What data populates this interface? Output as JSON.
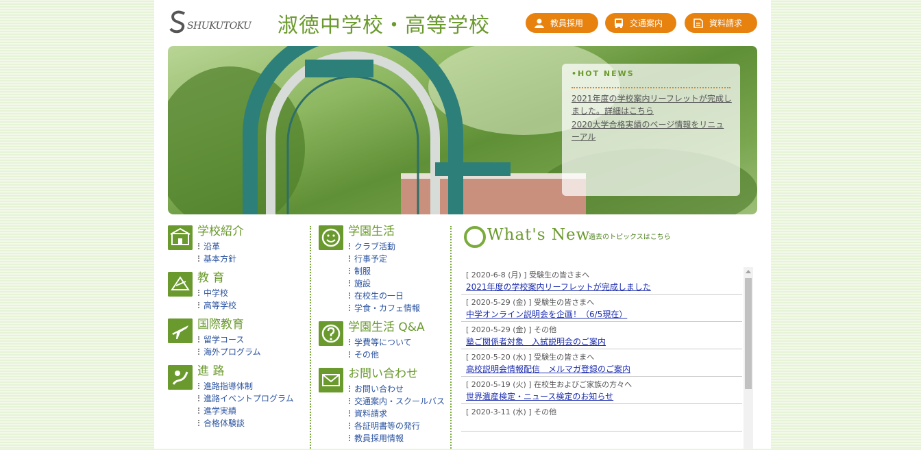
{
  "header": {
    "logo_text": "SHUKUTOKU",
    "school_name": "淑徳中学校・高等学校",
    "buttons": [
      {
        "label": "教員採用",
        "icon": "person-icon"
      },
      {
        "label": "交通案内",
        "icon": "bus-icon"
      },
      {
        "label": "資料請求",
        "icon": "document-icon"
      }
    ]
  },
  "hot_news": {
    "title": "•HOT NEWS",
    "items": [
      "2021年度の学校案内リーフレットが完成しました。詳細はこちら",
      "2020大学合格実績のページ情報をリニューアル"
    ]
  },
  "menu": {
    "col1": [
      {
        "title": "学校紹介",
        "icon": "school-building-icon",
        "links": [
          "沿革",
          "基本方針"
        ]
      },
      {
        "title": "教 育",
        "icon": "education-icon",
        "links": [
          "中学校",
          "高等学校"
        ]
      },
      {
        "title": "国際教育",
        "icon": "airplane-icon",
        "links": [
          "留学コース",
          "海外プログラム"
        ]
      },
      {
        "title": "進 路",
        "icon": "career-icon",
        "links": [
          "進路指導体制",
          "進路イベントプログラム",
          "進学実績",
          "合格体験談"
        ]
      }
    ],
    "col2": [
      {
        "title": "学園生活",
        "icon": "smiley-icon",
        "links": [
          "クラブ活動",
          "行事予定",
          "制服",
          "施設",
          "在校生の一日",
          "学食・カフェ情報"
        ]
      },
      {
        "title": "学園生活 Q&A",
        "icon": "question-icon",
        "links": [
          "学費等について",
          "その他"
        ]
      },
      {
        "title": "お問い合わせ",
        "icon": "mail-icon",
        "links": [
          "お問い合わせ",
          "交通案内・スクールバス",
          "資料請求",
          "各証明書等の発行",
          "教員採用情報"
        ]
      }
    ]
  },
  "whats_new": {
    "title": "What's New",
    "past_link": "過去のトピックスはこちら",
    "items": [
      {
        "meta": "[ 2020-6-8 (月) ] 受験生の皆さまへ",
        "link": "2021年度の学校案内リーフレットが完成しました"
      },
      {
        "meta": "[ 2020-5-29 (金) ] 受験生の皆さまへ",
        "link": "中学オンライン説明会を企画！（6/5現在）"
      },
      {
        "meta": "[ 2020-5-29 (金) ] その他",
        "link": "塾ご関係者対象　入試説明会のご案内"
      },
      {
        "meta": "[ 2020-5-20 (水) ] 受験生の皆さまへ",
        "link": "高校説明会情報配信　メルマガ登録のご案内"
      },
      {
        "meta": "[ 2020-5-19 (火) ] 在校生およびご家族の方々へ",
        "link": "世界遺産検定・ニュース検定のお知らせ"
      },
      {
        "meta": "[ 2020-3-11 (水) ] その他",
        "link": ""
      }
    ]
  },
  "colors": {
    "accent_orange": "#e8820f",
    "brand_green": "#6b9a2e",
    "link_blue": "#1e2fb0"
  }
}
